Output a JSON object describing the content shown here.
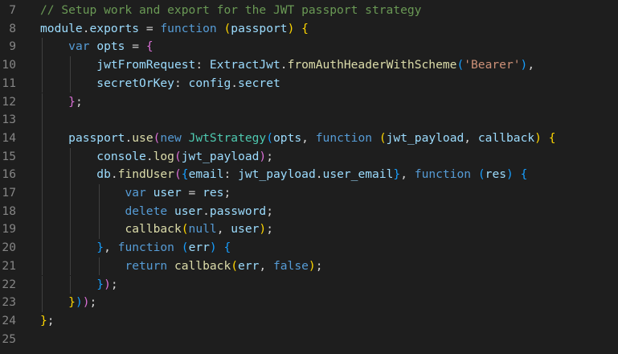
{
  "editor": {
    "language": "javascript",
    "colors": {
      "background": "#1e1e1e",
      "line_number": "#858585",
      "comment": "#6a9955",
      "keyword": "#569cd6",
      "variable": "#9cdcfe",
      "function": "#dcdcaa",
      "type": "#4ec9b0",
      "string": "#ce9178",
      "punctuation": "#d4d4d4",
      "bracket_level_1": "#ffd700",
      "bracket_level_2": "#da70d6",
      "bracket_level_3": "#179fff"
    },
    "lines": [
      {
        "number": "7",
        "tokens": [
          {
            "t": "c",
            "v": "// Setup work and export for the JWT passport strategy"
          }
        ]
      },
      {
        "number": "8",
        "tokens": [
          {
            "t": "v",
            "v": "module"
          },
          {
            "t": "p",
            "v": "."
          },
          {
            "t": "v",
            "v": "exports"
          },
          {
            "t": "p",
            "v": " = "
          },
          {
            "t": "k",
            "v": "function"
          },
          {
            "t": "p",
            "v": " "
          },
          {
            "t": "b1",
            "v": "("
          },
          {
            "t": "v",
            "v": "passport"
          },
          {
            "t": "b1",
            "v": ")"
          },
          {
            "t": "p",
            "v": " "
          },
          {
            "t": "b1",
            "v": "{"
          }
        ]
      },
      {
        "number": "9",
        "tokens": [
          {
            "t": "p",
            "v": "    "
          },
          {
            "t": "k",
            "v": "var"
          },
          {
            "t": "p",
            "v": " "
          },
          {
            "t": "v",
            "v": "opts"
          },
          {
            "t": "p",
            "v": " = "
          },
          {
            "t": "b2",
            "v": "{"
          }
        ]
      },
      {
        "number": "10",
        "tokens": [
          {
            "t": "p",
            "v": "        "
          },
          {
            "t": "v",
            "v": "jwtFromRequest"
          },
          {
            "t": "p",
            "v": ": "
          },
          {
            "t": "v",
            "v": "ExtractJwt"
          },
          {
            "t": "p",
            "v": "."
          },
          {
            "t": "f",
            "v": "fromAuthHeaderWithScheme"
          },
          {
            "t": "b3",
            "v": "("
          },
          {
            "t": "s",
            "v": "'Bearer'"
          },
          {
            "t": "b3",
            "v": ")"
          },
          {
            "t": "p",
            "v": ","
          }
        ]
      },
      {
        "number": "11",
        "tokens": [
          {
            "t": "p",
            "v": "        "
          },
          {
            "t": "v",
            "v": "secretOrKey"
          },
          {
            "t": "p",
            "v": ": "
          },
          {
            "t": "v",
            "v": "config"
          },
          {
            "t": "p",
            "v": "."
          },
          {
            "t": "v",
            "v": "secret"
          }
        ]
      },
      {
        "number": "12",
        "tokens": [
          {
            "t": "p",
            "v": "    "
          },
          {
            "t": "b2",
            "v": "}"
          },
          {
            "t": "p",
            "v": ";"
          }
        ]
      },
      {
        "number": "13",
        "tokens": []
      },
      {
        "number": "14",
        "tokens": [
          {
            "t": "p",
            "v": "    "
          },
          {
            "t": "v",
            "v": "passport"
          },
          {
            "t": "p",
            "v": "."
          },
          {
            "t": "f",
            "v": "use"
          },
          {
            "t": "b2",
            "v": "("
          },
          {
            "t": "k",
            "v": "new"
          },
          {
            "t": "p",
            "v": " "
          },
          {
            "t": "t",
            "v": "JwtStrategy"
          },
          {
            "t": "b3",
            "v": "("
          },
          {
            "t": "v",
            "v": "opts"
          },
          {
            "t": "p",
            "v": ", "
          },
          {
            "t": "k",
            "v": "function"
          },
          {
            "t": "p",
            "v": " "
          },
          {
            "t": "b1",
            "v": "("
          },
          {
            "t": "v",
            "v": "jwt_payload"
          },
          {
            "t": "p",
            "v": ", "
          },
          {
            "t": "v",
            "v": "callback"
          },
          {
            "t": "b1",
            "v": ")"
          },
          {
            "t": "p",
            "v": " "
          },
          {
            "t": "b1",
            "v": "{"
          }
        ]
      },
      {
        "number": "15",
        "tokens": [
          {
            "t": "p",
            "v": "        "
          },
          {
            "t": "v",
            "v": "console"
          },
          {
            "t": "p",
            "v": "."
          },
          {
            "t": "f",
            "v": "log"
          },
          {
            "t": "b2",
            "v": "("
          },
          {
            "t": "v",
            "v": "jwt_payload"
          },
          {
            "t": "b2",
            "v": ")"
          },
          {
            "t": "p",
            "v": ";"
          }
        ]
      },
      {
        "number": "16",
        "tokens": [
          {
            "t": "p",
            "v": "        "
          },
          {
            "t": "v",
            "v": "db"
          },
          {
            "t": "p",
            "v": "."
          },
          {
            "t": "f",
            "v": "findUser"
          },
          {
            "t": "b2",
            "v": "("
          },
          {
            "t": "b3",
            "v": "{"
          },
          {
            "t": "v",
            "v": "email"
          },
          {
            "t": "p",
            "v": ": "
          },
          {
            "t": "v",
            "v": "jwt_payload"
          },
          {
            "t": "p",
            "v": "."
          },
          {
            "t": "v",
            "v": "user_email"
          },
          {
            "t": "b3",
            "v": "}"
          },
          {
            "t": "p",
            "v": ", "
          },
          {
            "t": "k",
            "v": "function"
          },
          {
            "t": "p",
            "v": " "
          },
          {
            "t": "b3",
            "v": "("
          },
          {
            "t": "v",
            "v": "res"
          },
          {
            "t": "b3",
            "v": ")"
          },
          {
            "t": "p",
            "v": " "
          },
          {
            "t": "b3",
            "v": "{"
          }
        ]
      },
      {
        "number": "17",
        "tokens": [
          {
            "t": "p",
            "v": "            "
          },
          {
            "t": "k",
            "v": "var"
          },
          {
            "t": "p",
            "v": " "
          },
          {
            "t": "v",
            "v": "user"
          },
          {
            "t": "p",
            "v": " = "
          },
          {
            "t": "v",
            "v": "res"
          },
          {
            "t": "p",
            "v": ";"
          }
        ]
      },
      {
        "number": "18",
        "tokens": [
          {
            "t": "p",
            "v": "            "
          },
          {
            "t": "k",
            "v": "delete"
          },
          {
            "t": "p",
            "v": " "
          },
          {
            "t": "v",
            "v": "user"
          },
          {
            "t": "p",
            "v": "."
          },
          {
            "t": "v",
            "v": "password"
          },
          {
            "t": "p",
            "v": ";"
          }
        ]
      },
      {
        "number": "19",
        "tokens": [
          {
            "t": "p",
            "v": "            "
          },
          {
            "t": "f",
            "v": "callback"
          },
          {
            "t": "b1",
            "v": "("
          },
          {
            "t": "k",
            "v": "null"
          },
          {
            "t": "p",
            "v": ", "
          },
          {
            "t": "v",
            "v": "user"
          },
          {
            "t": "b1",
            "v": ")"
          },
          {
            "t": "p",
            "v": ";"
          }
        ]
      },
      {
        "number": "20",
        "tokens": [
          {
            "t": "p",
            "v": "        "
          },
          {
            "t": "b3",
            "v": "}"
          },
          {
            "t": "p",
            "v": ", "
          },
          {
            "t": "k",
            "v": "function"
          },
          {
            "t": "p",
            "v": " "
          },
          {
            "t": "b3",
            "v": "("
          },
          {
            "t": "v",
            "v": "err"
          },
          {
            "t": "b3",
            "v": ")"
          },
          {
            "t": "p",
            "v": " "
          },
          {
            "t": "b3",
            "v": "{"
          }
        ]
      },
      {
        "number": "21",
        "tokens": [
          {
            "t": "p",
            "v": "            "
          },
          {
            "t": "k",
            "v": "return"
          },
          {
            "t": "p",
            "v": " "
          },
          {
            "t": "f",
            "v": "callback"
          },
          {
            "t": "b1",
            "v": "("
          },
          {
            "t": "v",
            "v": "err"
          },
          {
            "t": "p",
            "v": ", "
          },
          {
            "t": "k",
            "v": "false"
          },
          {
            "t": "b1",
            "v": ")"
          },
          {
            "t": "p",
            "v": ";"
          }
        ]
      },
      {
        "number": "22",
        "tokens": [
          {
            "t": "p",
            "v": "        "
          },
          {
            "t": "b3",
            "v": "}"
          },
          {
            "t": "b2",
            "v": ")"
          },
          {
            "t": "p",
            "v": ";"
          }
        ]
      },
      {
        "number": "23",
        "tokens": [
          {
            "t": "p",
            "v": "    "
          },
          {
            "t": "b1",
            "v": "}"
          },
          {
            "t": "b3",
            "v": ")"
          },
          {
            "t": "b2",
            "v": ")"
          },
          {
            "t": "p",
            "v": ";"
          }
        ]
      },
      {
        "number": "24",
        "tokens": [
          {
            "t": "b1",
            "v": "}"
          },
          {
            "t": "p",
            "v": ";"
          }
        ]
      },
      {
        "number": "25",
        "tokens": []
      }
    ]
  }
}
